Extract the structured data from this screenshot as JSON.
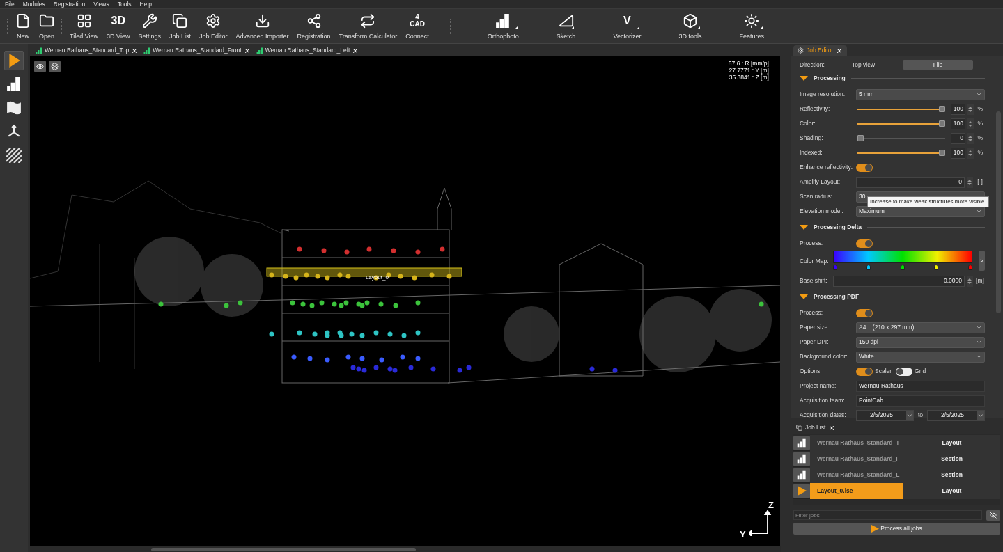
{
  "menu": [
    "File",
    "Modules",
    "Registration",
    "Views",
    "Tools",
    "Help"
  ],
  "toolbar": {
    "groups": [
      [
        {
          "label": "New"
        },
        {
          "label": "Open"
        }
      ],
      [
        {
          "label": "Tiled View"
        },
        {
          "label": "3D View",
          "glyph": [
            "3D"
          ]
        },
        {
          "label": "Settings"
        },
        {
          "label": "Job List"
        },
        {
          "label": "Job Editor"
        },
        {
          "label": "Advanced Importer"
        },
        {
          "label": "Registration"
        },
        {
          "label": "Transform Calculator"
        },
        {
          "label": "Connect",
          "glyph": [
            "4",
            "CAD"
          ]
        }
      ],
      [
        {
          "label": "Orthophoto",
          "has_menu": true
        },
        {
          "label": "Sketch",
          "has_menu": true
        },
        {
          "label": "Vectorizer",
          "glyph": [
            "V"
          ],
          "has_menu": true
        },
        {
          "label": "3D tools",
          "has_menu": true
        },
        {
          "label": "Features",
          "has_menu": true
        }
      ]
    ]
  },
  "left_tools": [
    {
      "selected": true
    },
    {
      "selected": false
    },
    {
      "selected": false
    },
    {
      "selected": false
    },
    {
      "selected": false
    }
  ],
  "doc_tabs": [
    {
      "label": "Wernau Rathaus_Standard_Top"
    },
    {
      "label": "Wernau Rathaus_Standard_Front"
    },
    {
      "label": "Wernau Rathaus_Standard_Left"
    }
  ],
  "viewport": {
    "readout": [
      "57.6 : R [mm/p]",
      "27.7771 : Y [m]",
      "35.3841 : Z [m]"
    ],
    "layout_label": "Layout_0",
    "axis_z": "Z",
    "axis_y": "Y"
  },
  "job_editor": {
    "title": "Job Editor",
    "direction": {
      "label": "Direction:",
      "value": "Top view",
      "button": "Flip"
    },
    "processing": {
      "title": "Processing",
      "expanded": true,
      "rows": [
        {
          "kind": "select",
          "label": "Image resolution:",
          "value": "5 mm"
        },
        {
          "kind": "slider",
          "label": "Reflectivity:",
          "level": 1,
          "value": "100",
          "unit": "%"
        },
        {
          "kind": "slider",
          "label": "Color:",
          "level": 1,
          "value": "100",
          "unit": "%"
        },
        {
          "kind": "slider",
          "label": "Shading:",
          "level": 0,
          "value": "0",
          "unit": "%"
        },
        {
          "kind": "slider",
          "label": "Indexed:",
          "level": 1,
          "value": "100",
          "unit": "%"
        },
        {
          "kind": "toggle",
          "label": "Enhance reflectivity:",
          "on": true
        },
        {
          "kind": "number",
          "label": "Amplify Layout:",
          "value": "0",
          "unit": "[-]"
        },
        {
          "kind": "select",
          "label": "Scan radius:",
          "value": "30"
        },
        {
          "kind": "select",
          "label": "Elevation model:",
          "value": "Maximum"
        }
      ],
      "tooltip": "Increase to make weak structures more visible."
    },
    "delta": {
      "title": "Processing Delta",
      "expanded": true,
      "process_label": "Process:",
      "process_on": true,
      "color_map_label": "Color Map:",
      "color_map_button": ">",
      "stops": [
        {
          "color": "#3a00ff"
        },
        {
          "color": "#00c8ff"
        },
        {
          "color": "#00e000"
        },
        {
          "color": "#f0f000"
        },
        {
          "color": "#ff0000"
        }
      ],
      "base_shift": {
        "label": "Base shift:",
        "value": "0.0000",
        "unit": "[m]"
      }
    },
    "pdf": {
      "title": "Processing PDF",
      "expanded": true,
      "rows": [
        {
          "kind": "toggle",
          "label": "Process:",
          "on": true
        },
        {
          "kind": "select",
          "label": "Paper size:",
          "value": "A4    (210 x 297 mm)"
        },
        {
          "kind": "select",
          "label": "Paper DPI:",
          "value": "150 dpi"
        },
        {
          "kind": "select",
          "label": "Background color:",
          "value": "White"
        },
        {
          "kind": "options",
          "label": "Options:",
          "options": [
            {
              "label": "Scaler",
              "on": true
            },
            {
              "label": "Grid",
              "on": false
            }
          ]
        },
        {
          "kind": "text",
          "label": "Project name:",
          "value": "Wernau Rathaus"
        },
        {
          "kind": "text",
          "label": "Acquisition team:",
          "value": "PointCab"
        },
        {
          "kind": "dates",
          "label": "Acquisition dates:",
          "from": "2/5/2025",
          "to_label": "to",
          "to": "2/5/2025"
        }
      ]
    }
  },
  "job_list": {
    "title": "Job List",
    "rows": [
      {
        "kind": "ortho",
        "name": "Wernau Rathaus_Standard_T",
        "type": "Layout",
        "selected": false
      },
      {
        "kind": "ortho",
        "name": "Wernau Rathaus_Standard_F",
        "type": "Section",
        "selected": false
      },
      {
        "kind": "ortho",
        "name": "Wernau Rathaus_Standard_L",
        "type": "Section",
        "selected": false
      },
      {
        "kind": "play",
        "name": "Layout_0.lse",
        "type": "Layout",
        "selected": true
      }
    ],
    "filter_placeholder": "Filter jobs",
    "process_button": "Process all jobs"
  }
}
